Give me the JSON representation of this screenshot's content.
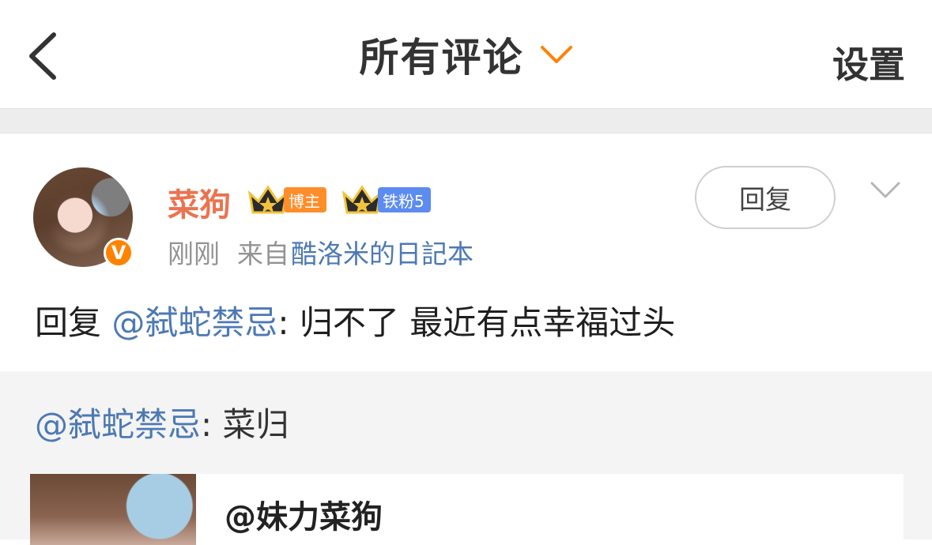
{
  "header": {
    "title": "所有评论",
    "settings_label": "设置",
    "icons": {
      "back": "back-arrow-icon",
      "title_dropdown": "chevron-down-icon"
    },
    "accent_color": "#ff8200"
  },
  "comment": {
    "username": "菜狗",
    "badges": [
      {
        "icon": "crown-icon",
        "label": "博主",
        "color": "#ff8d2a"
      },
      {
        "icon": "crown-icon",
        "label": "铁粉5",
        "color": "#5d8cf0"
      }
    ],
    "verified_badge": "V",
    "time": "刚刚",
    "source_prefix": "来自",
    "source": "酷洛米的日記本",
    "reply_button": "回复",
    "content_prefix": "回复 ",
    "content_mention": "@弑蛇禁忌",
    "content_text": ": 归不了 最近有点幸福过头"
  },
  "quote": {
    "mention": "@弑蛇禁忌",
    "text": ": 菜归",
    "card_title": "@妹力菜狗"
  }
}
